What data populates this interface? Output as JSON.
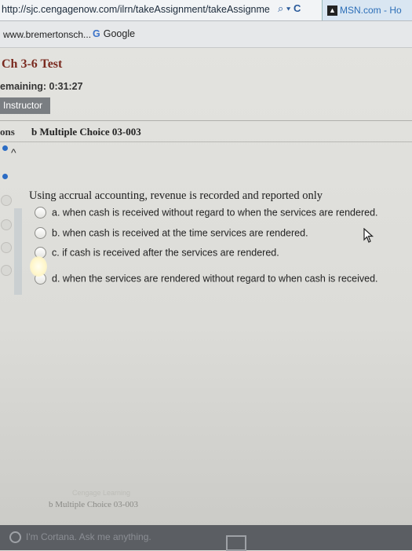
{
  "browser": {
    "url": "http://sjc.cengagenow.com/ilrn/takeAssignment/takeAssignme",
    "search_symbol": "⌕",
    "dropdown_symbol": "▾",
    "refresh_symbol": "C",
    "tab_label": "MSN.com - Ho",
    "favorites": [
      "www.bremertonsch...",
      "Google"
    ]
  },
  "test": {
    "title": "Ch 3-6 Test",
    "remaining": "emaining: 0:31:27",
    "instructor_tab": "Instructor"
  },
  "question_header": {
    "left_fragment": "ons",
    "name": "b Multiple Choice 03-003"
  },
  "question": {
    "text": "Using accrual accounting, revenue is recorded and reported only",
    "options": [
      {
        "label": "a. when cash is received without regard to when the services are rendered."
      },
      {
        "label": "b. when cash is received at the time services are rendered."
      },
      {
        "label": "c. if cash is received after the services are rendered."
      },
      {
        "label": "d. when the services are rendered without regard to when cash is received."
      }
    ]
  },
  "footer": {
    "question_name": "b Multiple Choice 03-003",
    "faded_text": "Cengage Learning"
  },
  "taskbar": {
    "cortana_placeholder": "I'm Cortana. Ask me anything."
  },
  "colors": {
    "title": "#7a2a1f",
    "nav_dot": "#2b6cc4",
    "instructor_tab_bg": "#7a7e82"
  }
}
